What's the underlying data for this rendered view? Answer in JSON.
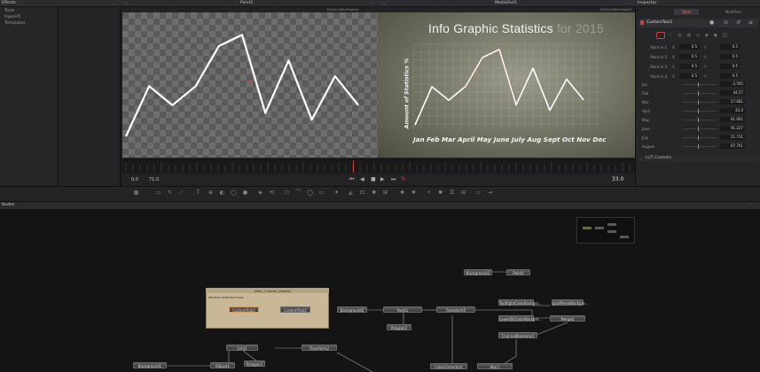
{
  "panels": {
    "effects_title": "Effects",
    "effects_items": [
      "Tools",
      "OpenFX",
      "Templates"
    ],
    "viewer1_title": "Paint1",
    "viewer2_title": "MediaOut1",
    "inspector_title": "Inspector",
    "nodes_title": "Nodes",
    "viewer1_res": "1920x1080xFloat16",
    "viewer2_res": "1920x1080xFloat16"
  },
  "infographic": {
    "title": "Info Graphic Statistics",
    "title_suffix": "for 2015",
    "ylabel": "Amount of Statistics %",
    "months_line": "Jan Feb Mar April May June July Aug Sept Oct Nov Dec"
  },
  "transport": {
    "frame_start": "0.0",
    "frame_end": "71.0",
    "current_frame": "33.0"
  },
  "inspector": {
    "tab_tools": "Tools",
    "tab_modifiers": "Modifiers",
    "node_name": "CustomTool1",
    "points": [
      {
        "label": "Point in 1",
        "x_label": "X",
        "x": "0.5",
        "y_label": "Y",
        "y": "0.5"
      },
      {
        "label": "Point in 2",
        "x_label": "X",
        "x": "0.5",
        "y_label": "Y",
        "y": "0.5"
      },
      {
        "label": "Point in 3",
        "x_label": "X",
        "x": "0.5",
        "y_label": "Y",
        "y": "0.5"
      },
      {
        "label": "Point in 4",
        "x_label": "X",
        "x": "0.5",
        "y_label": "Y",
        "y": "0.5"
      }
    ],
    "months": [
      {
        "label": "Jan",
        "value": "-3.595"
      },
      {
        "label": "Feb",
        "value": "44.57"
      },
      {
        "label": "Mar",
        "value": "27.681"
      },
      {
        "label": "April",
        "value": "45.0"
      },
      {
        "label": "May",
        "value": "81.091"
      },
      {
        "label": "June",
        "value": "91.227"
      },
      {
        "label": "July",
        "value": "21.731"
      },
      {
        "label": "August",
        "value": "67.701"
      }
    ],
    "lut_controls": "LUT Controls"
  },
  "note": {
    "title": "Note_Custom_Months",
    "text": "Months entered here"
  },
  "nodes": {
    "background3": "Background3",
    "paint2": "Paint2",
    "background2": "Background2",
    "paint1": "Paint1",
    "transform5": "Transform5",
    "topright_bg": "TopRightColorBackgro...",
    "gradient": "gradResetBackgro...",
    "lower_bg": "LowerBGColorBackgro...",
    "merge5": "Merge5",
    "channel_booleans": "ChannelBooleans1",
    "polygon2": "Polygon2",
    "custom_tool1": "CustomTool1",
    "custom_tool2": "CustomTool2",
    "grid1": "Grid1",
    "transform2": "Transform2",
    "background1": "Background1",
    "ellipse1": "Ellipse1",
    "polygon1": "Polygon1",
    "color_corrector1": "ColorCorrector1",
    "blur1": "Blur1"
  },
  "chart_data": [
    {
      "type": "line",
      "x": [
        1,
        2,
        3,
        4,
        5,
        6,
        7,
        8,
        9,
        10,
        11
      ],
      "values": [
        0,
        45,
        28,
        45,
        81,
        91,
        21,
        68,
        15,
        54,
        28
      ],
      "ylim": [
        0,
        100
      ]
    },
    {
      "type": "line",
      "categories": [
        "Jan",
        "Feb",
        "Mar",
        "April",
        "May",
        "June",
        "July",
        "Aug",
        "Sept",
        "Oct",
        "Nov",
        "Dec"
      ],
      "values": [
        -3.595,
        44.57,
        27.681,
        45.0,
        81.091,
        91.227,
        21.731,
        67.701,
        15,
        54,
        28,
        33
      ],
      "ylim": [
        0,
        100
      ]
    }
  ],
  "colors": {
    "accent": "#c84040",
    "node_selected": "#d8a060",
    "note": "#c8b898"
  }
}
